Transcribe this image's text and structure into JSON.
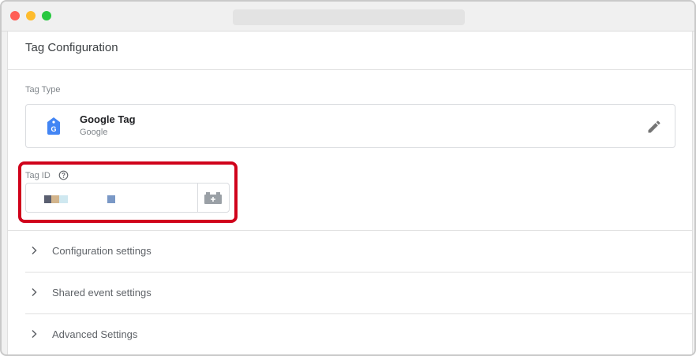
{
  "window": {
    "controls": [
      "close",
      "minimize",
      "zoom"
    ]
  },
  "panel": {
    "title": "Tag Configuration"
  },
  "tag_type": {
    "label": "Tag Type",
    "name": "Google Tag",
    "vendor": "Google",
    "icon": "google-tag-icon",
    "brand_color": "#4285f4"
  },
  "tag_id": {
    "label": "Tag ID",
    "help_icon": "help-circle-icon",
    "value_redacted": true,
    "variable_icon": "variable-brick-icon",
    "highlight_color": "#d0021b"
  },
  "sections": [
    {
      "label": "Configuration settings",
      "icon": "chevron-right-icon"
    },
    {
      "label": "Shared event settings",
      "icon": "chevron-right-icon"
    },
    {
      "label": "Advanced Settings",
      "icon": "chevron-right-icon"
    }
  ]
}
